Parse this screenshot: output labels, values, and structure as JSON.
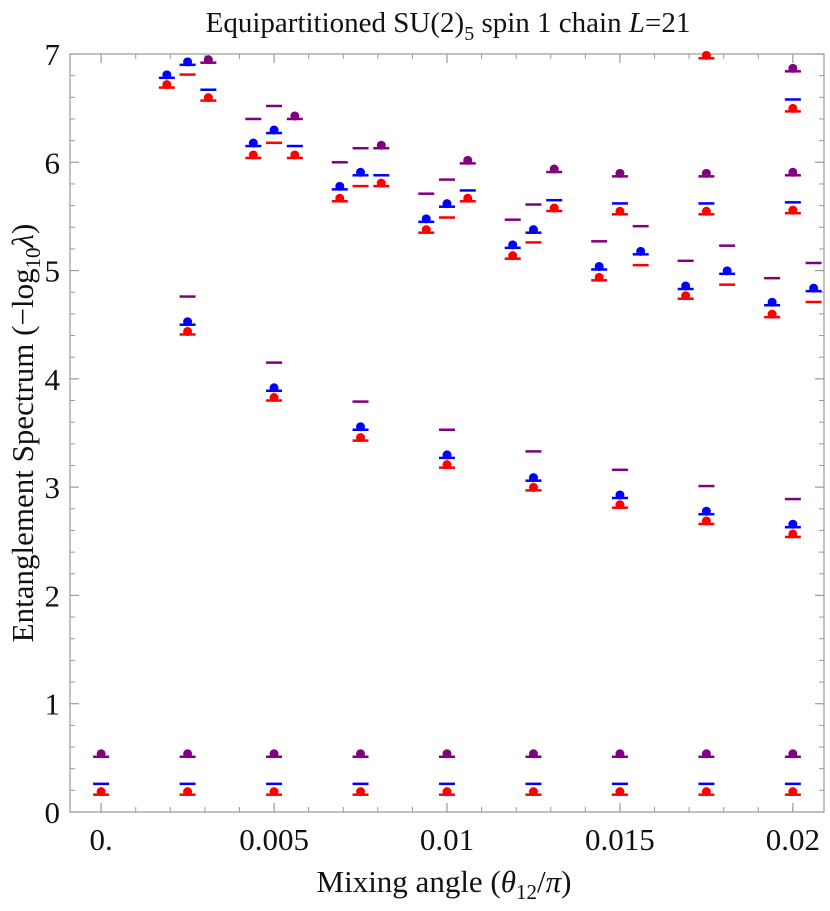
{
  "colors": {
    "red": "#ff0000",
    "blue": "#0000ff",
    "purple": "#800080",
    "axis": "#999999",
    "text": "#111111"
  },
  "chart_data": {
    "type": "scatter",
    "title": {
      "prefix": "Equipartitioned SU(2)",
      "sub": "5",
      "suffix": " spin 1 chain ",
      "var": "L",
      "eq": "=21"
    },
    "xlabel": {
      "prefix": "Mixing angle (",
      "theta": "θ",
      "sub": "12",
      "slash": "/",
      "pi": "π",
      "suffix": ")"
    },
    "ylabel": {
      "prefix": "Entanglement  Spectrum (−log",
      "sub": "10",
      "lambda": "λ",
      "suffix": ")"
    },
    "xlim": [
      -0.0009,
      0.0209
    ],
    "ylim": [
      0,
      7
    ],
    "x_ticks": [
      {
        "value": 0,
        "label": "0."
      },
      {
        "value": 0.005,
        "label": "0.005"
      },
      {
        "value": 0.01,
        "label": "0.01"
      },
      {
        "value": 0.015,
        "label": "0.015"
      },
      {
        "value": 0.02,
        "label": "0.02"
      }
    ],
    "y_ticks": [
      {
        "value": 0,
        "label": "0"
      },
      {
        "value": 1,
        "label": "1"
      },
      {
        "value": 2,
        "label": "2"
      },
      {
        "value": 3,
        "label": "3"
      },
      {
        "value": 4,
        "label": "4"
      },
      {
        "value": 5,
        "label": "5"
      },
      {
        "value": 6,
        "label": "6"
      },
      {
        "value": 7,
        "label": "7"
      }
    ],
    "grid": false,
    "marker_styles": [
      "dot-bar",
      "bar"
    ],
    "series": [
      {
        "color": "red",
        "points": [
          {
            "x": 0.0,
            "y": 0.16,
            "marker": "dot-bar"
          },
          {
            "x": 0.0025,
            "y": 0.16,
            "marker": "dot-bar"
          },
          {
            "x": 0.005,
            "y": 0.16,
            "marker": "dot-bar"
          },
          {
            "x": 0.0075,
            "y": 0.16,
            "marker": "dot-bar"
          },
          {
            "x": 0.01,
            "y": 0.16,
            "marker": "dot-bar"
          },
          {
            "x": 0.0125,
            "y": 0.16,
            "marker": "dot-bar"
          },
          {
            "x": 0.015,
            "y": 0.16,
            "marker": "dot-bar"
          },
          {
            "x": 0.0175,
            "y": 0.16,
            "marker": "dot-bar"
          },
          {
            "x": 0.02,
            "y": 0.16,
            "marker": "dot-bar"
          },
          {
            "x": 0.0025,
            "y": 4.41,
            "marker": "dot-bar"
          },
          {
            "x": 0.005,
            "y": 3.8,
            "marker": "dot-bar"
          },
          {
            "x": 0.0075,
            "y": 3.43,
            "marker": "dot-bar"
          },
          {
            "x": 0.01,
            "y": 3.18,
            "marker": "dot-bar"
          },
          {
            "x": 0.0125,
            "y": 2.97,
            "marker": "dot-bar"
          },
          {
            "x": 0.015,
            "y": 2.81,
            "marker": "dot-bar"
          },
          {
            "x": 0.0175,
            "y": 2.66,
            "marker": "dot-bar"
          },
          {
            "x": 0.02,
            "y": 2.54,
            "marker": "dot-bar"
          },
          {
            "x": 0.0019,
            "y": 6.69,
            "marker": "dot-bar"
          },
          {
            "x": 0.0025,
            "y": 6.81,
            "marker": "bar"
          },
          {
            "x": 0.0031,
            "y": 6.57,
            "marker": "dot-bar"
          },
          {
            "x": 0.0044,
            "y": 6.04,
            "marker": "dot-bar"
          },
          {
            "x": 0.005,
            "y": 6.18,
            "marker": "bar"
          },
          {
            "x": 0.0056,
            "y": 6.04,
            "marker": "dot-bar"
          },
          {
            "x": 0.0069,
            "y": 5.64,
            "marker": "dot-bar"
          },
          {
            "x": 0.0075,
            "y": 5.78,
            "marker": "bar"
          },
          {
            "x": 0.0081,
            "y": 5.78,
            "marker": "dot-bar"
          },
          {
            "x": 0.0094,
            "y": 5.35,
            "marker": "dot-bar"
          },
          {
            "x": 0.01,
            "y": 5.49,
            "marker": "bar"
          },
          {
            "x": 0.0106,
            "y": 5.64,
            "marker": "dot-bar"
          },
          {
            "x": 0.0119,
            "y": 5.11,
            "marker": "dot-bar"
          },
          {
            "x": 0.0125,
            "y": 5.26,
            "marker": "bar"
          },
          {
            "x": 0.0131,
            "y": 5.55,
            "marker": "dot-bar"
          },
          {
            "x": 0.0144,
            "y": 4.91,
            "marker": "dot-bar"
          },
          {
            "x": 0.015,
            "y": 5.52,
            "marker": "dot-bar"
          },
          {
            "x": 0.0156,
            "y": 5.05,
            "marker": "bar"
          },
          {
            "x": 0.0169,
            "y": 4.74,
            "marker": "dot-bar"
          },
          {
            "x": 0.0175,
            "y": 5.52,
            "marker": "dot-bar"
          },
          {
            "x": 0.0181,
            "y": 4.87,
            "marker": "bar"
          },
          {
            "x": 0.0175,
            "y": 6.96,
            "marker": "dot-bar"
          },
          {
            "x": 0.0194,
            "y": 4.57,
            "marker": "dot-bar"
          },
          {
            "x": 0.02,
            "y": 5.53,
            "marker": "dot-bar"
          },
          {
            "x": 0.0206,
            "y": 4.71,
            "marker": "bar"
          },
          {
            "x": 0.02,
            "y": 6.47,
            "marker": "dot-bar"
          }
        ]
      },
      {
        "color": "blue",
        "points": [
          {
            "x": 0.0,
            "y": 0.26,
            "marker": "bar"
          },
          {
            "x": 0.0025,
            "y": 0.26,
            "marker": "bar"
          },
          {
            "x": 0.005,
            "y": 0.26,
            "marker": "bar"
          },
          {
            "x": 0.0075,
            "y": 0.26,
            "marker": "bar"
          },
          {
            "x": 0.01,
            "y": 0.26,
            "marker": "bar"
          },
          {
            "x": 0.0125,
            "y": 0.26,
            "marker": "bar"
          },
          {
            "x": 0.015,
            "y": 0.26,
            "marker": "bar"
          },
          {
            "x": 0.0175,
            "y": 0.26,
            "marker": "bar"
          },
          {
            "x": 0.02,
            "y": 0.26,
            "marker": "bar"
          },
          {
            "x": 0.0025,
            "y": 4.5,
            "marker": "dot-bar"
          },
          {
            "x": 0.005,
            "y": 3.89,
            "marker": "dot-bar"
          },
          {
            "x": 0.0075,
            "y": 3.53,
            "marker": "dot-bar"
          },
          {
            "x": 0.01,
            "y": 3.27,
            "marker": "dot-bar"
          },
          {
            "x": 0.0125,
            "y": 3.06,
            "marker": "dot-bar"
          },
          {
            "x": 0.015,
            "y": 2.9,
            "marker": "dot-bar"
          },
          {
            "x": 0.0175,
            "y": 2.75,
            "marker": "dot-bar"
          },
          {
            "x": 0.02,
            "y": 2.63,
            "marker": "dot-bar"
          },
          {
            "x": 0.0019,
            "y": 6.78,
            "marker": "dot-bar"
          },
          {
            "x": 0.0025,
            "y": 6.9,
            "marker": "dot-bar"
          },
          {
            "x": 0.0031,
            "y": 6.67,
            "marker": "bar"
          },
          {
            "x": 0.0044,
            "y": 6.15,
            "marker": "dot-bar"
          },
          {
            "x": 0.005,
            "y": 6.27,
            "marker": "dot-bar"
          },
          {
            "x": 0.0056,
            "y": 6.15,
            "marker": "bar"
          },
          {
            "x": 0.0069,
            "y": 5.75,
            "marker": "dot-bar"
          },
          {
            "x": 0.0075,
            "y": 5.88,
            "marker": "dot-bar"
          },
          {
            "x": 0.0081,
            "y": 5.88,
            "marker": "bar"
          },
          {
            "x": 0.0094,
            "y": 5.45,
            "marker": "dot-bar"
          },
          {
            "x": 0.01,
            "y": 5.59,
            "marker": "dot-bar"
          },
          {
            "x": 0.0106,
            "y": 5.74,
            "marker": "bar"
          },
          {
            "x": 0.0119,
            "y": 5.21,
            "marker": "dot-bar"
          },
          {
            "x": 0.0125,
            "y": 5.35,
            "marker": "dot-bar"
          },
          {
            "x": 0.0131,
            "y": 5.65,
            "marker": "bar"
          },
          {
            "x": 0.0144,
            "y": 5.01,
            "marker": "dot-bar"
          },
          {
            "x": 0.015,
            "y": 5.62,
            "marker": "bar"
          },
          {
            "x": 0.0156,
            "y": 5.15,
            "marker": "dot-bar"
          },
          {
            "x": 0.0169,
            "y": 4.83,
            "marker": "dot-bar"
          },
          {
            "x": 0.0175,
            "y": 5.62,
            "marker": "bar"
          },
          {
            "x": 0.0181,
            "y": 4.97,
            "marker": "dot-bar"
          },
          {
            "x": 0.0194,
            "y": 4.68,
            "marker": "dot-bar"
          },
          {
            "x": 0.02,
            "y": 5.63,
            "marker": "bar"
          },
          {
            "x": 0.0206,
            "y": 4.81,
            "marker": "dot-bar"
          },
          {
            "x": 0.02,
            "y": 6.58,
            "marker": "bar"
          }
        ]
      },
      {
        "color": "purple",
        "points": [
          {
            "x": 0.0,
            "y": 0.51,
            "marker": "dot-bar"
          },
          {
            "x": 0.0025,
            "y": 0.51,
            "marker": "dot-bar"
          },
          {
            "x": 0.005,
            "y": 0.51,
            "marker": "dot-bar"
          },
          {
            "x": 0.0075,
            "y": 0.51,
            "marker": "dot-bar"
          },
          {
            "x": 0.01,
            "y": 0.51,
            "marker": "dot-bar"
          },
          {
            "x": 0.0125,
            "y": 0.51,
            "marker": "dot-bar"
          },
          {
            "x": 0.015,
            "y": 0.51,
            "marker": "dot-bar"
          },
          {
            "x": 0.0175,
            "y": 0.51,
            "marker": "dot-bar"
          },
          {
            "x": 0.02,
            "y": 0.51,
            "marker": "dot-bar"
          },
          {
            "x": 0.0025,
            "y": 4.76,
            "marker": "bar"
          },
          {
            "x": 0.005,
            "y": 4.15,
            "marker": "bar"
          },
          {
            "x": 0.0075,
            "y": 3.79,
            "marker": "bar"
          },
          {
            "x": 0.01,
            "y": 3.53,
            "marker": "bar"
          },
          {
            "x": 0.0125,
            "y": 3.33,
            "marker": "bar"
          },
          {
            "x": 0.015,
            "y": 3.16,
            "marker": "bar"
          },
          {
            "x": 0.0175,
            "y": 3.01,
            "marker": "bar"
          },
          {
            "x": 0.02,
            "y": 2.89,
            "marker": "bar"
          },
          {
            "x": 0.0031,
            "y": 6.92,
            "marker": "dot-bar"
          },
          {
            "x": 0.0044,
            "y": 6.4,
            "marker": "bar"
          },
          {
            "x": 0.005,
            "y": 6.52,
            "marker": "bar"
          },
          {
            "x": 0.0056,
            "y": 6.4,
            "marker": "dot-bar"
          },
          {
            "x": 0.0069,
            "y": 6.0,
            "marker": "bar"
          },
          {
            "x": 0.0075,
            "y": 6.13,
            "marker": "bar"
          },
          {
            "x": 0.0081,
            "y": 6.13,
            "marker": "dot-bar"
          },
          {
            "x": 0.0094,
            "y": 5.71,
            "marker": "bar"
          },
          {
            "x": 0.01,
            "y": 5.84,
            "marker": "bar"
          },
          {
            "x": 0.0106,
            "y": 5.99,
            "marker": "dot-bar"
          },
          {
            "x": 0.0119,
            "y": 5.47,
            "marker": "bar"
          },
          {
            "x": 0.0125,
            "y": 5.61,
            "marker": "bar"
          },
          {
            "x": 0.0131,
            "y": 5.91,
            "marker": "dot-bar"
          },
          {
            "x": 0.0144,
            "y": 5.27,
            "marker": "bar"
          },
          {
            "x": 0.015,
            "y": 5.87,
            "marker": "dot-bar"
          },
          {
            "x": 0.0156,
            "y": 5.41,
            "marker": "bar"
          },
          {
            "x": 0.0169,
            "y": 5.09,
            "marker": "bar"
          },
          {
            "x": 0.0175,
            "y": 5.87,
            "marker": "dot-bar"
          },
          {
            "x": 0.0181,
            "y": 5.23,
            "marker": "bar"
          },
          {
            "x": 0.0194,
            "y": 4.93,
            "marker": "bar"
          },
          {
            "x": 0.02,
            "y": 5.88,
            "marker": "dot-bar"
          },
          {
            "x": 0.0206,
            "y": 5.07,
            "marker": "bar"
          },
          {
            "x": 0.02,
            "y": 6.84,
            "marker": "dot-bar"
          }
        ]
      }
    ]
  }
}
